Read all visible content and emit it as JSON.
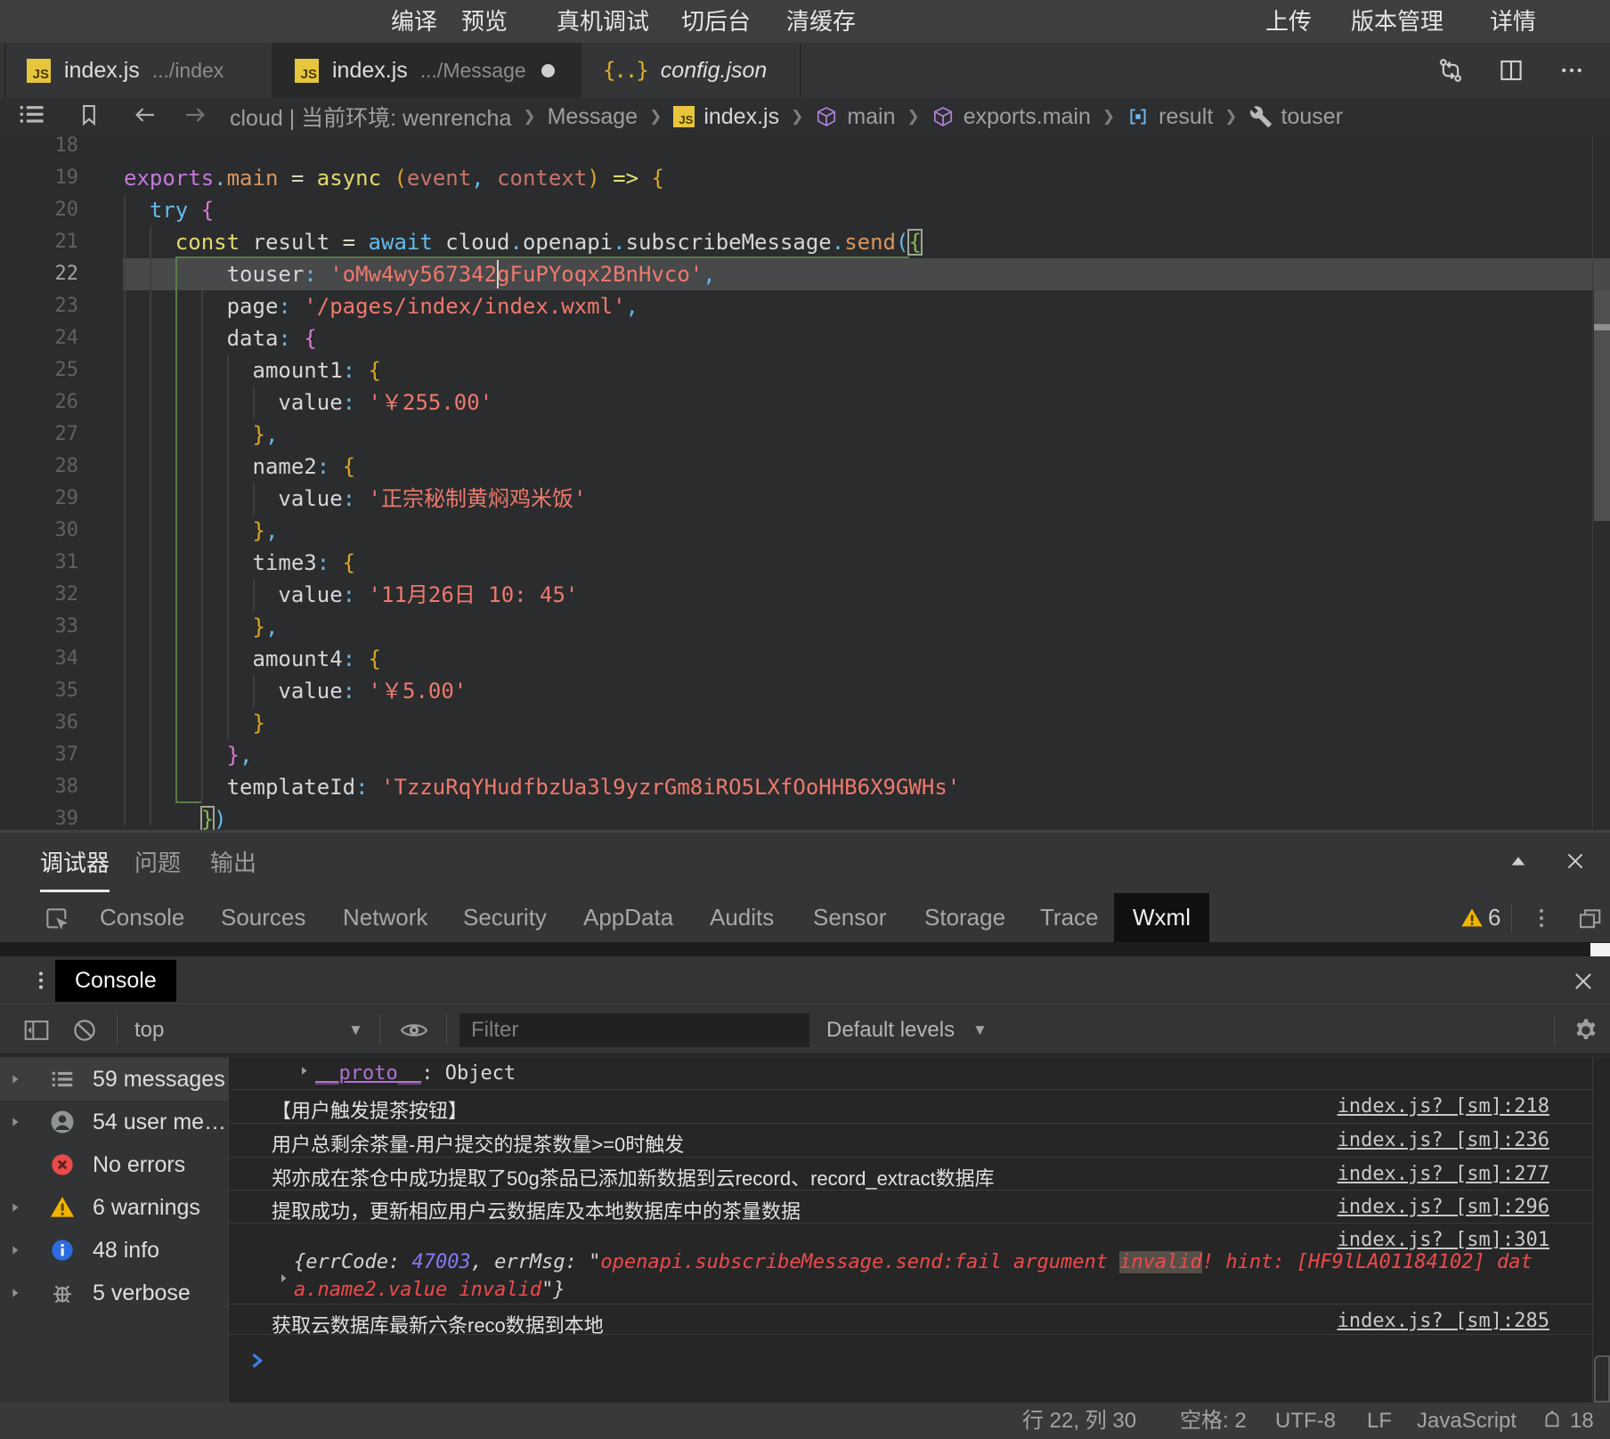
{
  "menubar": {
    "center_items": [
      "编译",
      "预览",
      "真机调试",
      "切后台",
      "清缓存"
    ],
    "right_items": [
      "上传",
      "版本管理",
      "详情"
    ]
  },
  "tabs": [
    {
      "title": "index.js",
      "hint": ".../index",
      "icon": "js",
      "active": false,
      "dirty": false,
      "italic": false
    },
    {
      "title": "index.js",
      "hint": ".../Message",
      "icon": "js",
      "active": true,
      "dirty": true,
      "italic": false
    },
    {
      "title": "config.json",
      "hint": "",
      "icon": "json",
      "active": false,
      "dirty": false,
      "italic": true
    }
  ],
  "breadcrumb": [
    {
      "label": "cloud | 当前环境: wenrencha",
      "icon": "",
      "bright": false
    },
    {
      "label": "Message",
      "icon": "",
      "bright": false
    },
    {
      "label": "index.js",
      "icon": "js",
      "bright": true
    },
    {
      "label": "main",
      "icon": "cube",
      "bright": false
    },
    {
      "label": "exports.main",
      "icon": "cube",
      "bright": false
    },
    {
      "label": "result",
      "icon": "field",
      "bright": false
    },
    {
      "label": "touser",
      "icon": "wrench",
      "bright": false
    }
  ],
  "editor": {
    "cursor": {
      "line": 22,
      "col": 29
    },
    "current_line": 22,
    "lines": [
      {
        "n": 18,
        "tokens": []
      },
      {
        "n": 19,
        "tokens": [
          [
            "pk",
            "exports"
          ],
          [
            "sk",
            "."
          ],
          [
            "or",
            "main"
          ],
          [
            "wh",
            " "
          ],
          [
            "op",
            "="
          ],
          [
            "wh",
            " "
          ],
          [
            "yl",
            "async"
          ],
          [
            "wh",
            " "
          ],
          [
            "gd",
            "("
          ],
          [
            "bk",
            "event"
          ],
          [
            "sk",
            ","
          ],
          [
            "wh",
            " "
          ],
          [
            "bk",
            "context"
          ],
          [
            "gd",
            ")"
          ],
          [
            "wh",
            " "
          ],
          [
            "aw",
            "=>"
          ],
          [
            "wh",
            " "
          ],
          [
            "gd",
            "{"
          ]
        ]
      },
      {
        "n": 20,
        "tokens": [
          [
            "wh",
            "  "
          ],
          [
            "sk",
            "try"
          ],
          [
            "wh",
            " "
          ],
          [
            "oc",
            "{"
          ]
        ]
      },
      {
        "n": 21,
        "tokens": [
          [
            "wh",
            "    "
          ],
          [
            "yl",
            "const"
          ],
          [
            "wh",
            " result "
          ],
          [
            "op",
            "="
          ],
          [
            "wh",
            " "
          ],
          [
            "sk",
            "await"
          ],
          [
            "wh",
            " cloud"
          ],
          [
            "sk",
            "."
          ],
          [
            "wh",
            "openapi"
          ],
          [
            "sk",
            "."
          ],
          [
            "wh",
            "subscribeMessage"
          ],
          [
            "sk",
            "."
          ],
          [
            "or",
            "send"
          ],
          [
            "sk",
            "("
          ],
          [
            "gr bm",
            "{"
          ]
        ]
      },
      {
        "n": 22,
        "tokens": [
          [
            "wh",
            "        touser"
          ],
          [
            "sk",
            ":"
          ],
          [
            "wh",
            " "
          ],
          [
            "st",
            "'oMw4wy567342gFuPYoqx2BnHvco'"
          ],
          [
            "sk",
            ","
          ]
        ]
      },
      {
        "n": 23,
        "tokens": [
          [
            "wh",
            "        page"
          ],
          [
            "sk",
            ":"
          ],
          [
            "wh",
            " "
          ],
          [
            "st",
            "'/pages/index/index.wxml'"
          ],
          [
            "sk",
            ","
          ]
        ]
      },
      {
        "n": 24,
        "tokens": [
          [
            "wh",
            "        data"
          ],
          [
            "sk",
            ":"
          ],
          [
            "wh",
            " "
          ],
          [
            "oc",
            "{"
          ]
        ]
      },
      {
        "n": 25,
        "tokens": [
          [
            "wh",
            "          amount1"
          ],
          [
            "sk",
            ":"
          ],
          [
            "wh",
            " "
          ],
          [
            "gd",
            "{"
          ]
        ]
      },
      {
        "n": 26,
        "tokens": [
          [
            "wh",
            "            value"
          ],
          [
            "sk",
            ":"
          ],
          [
            "wh",
            " "
          ],
          [
            "st",
            "'￥255.00'"
          ]
        ]
      },
      {
        "n": 27,
        "tokens": [
          [
            "wh",
            "          "
          ],
          [
            "gd",
            "}"
          ],
          [
            "sk",
            ","
          ]
        ]
      },
      {
        "n": 28,
        "tokens": [
          [
            "wh",
            "          name2"
          ],
          [
            "sk",
            ":"
          ],
          [
            "wh",
            " "
          ],
          [
            "gd",
            "{"
          ]
        ]
      },
      {
        "n": 29,
        "tokens": [
          [
            "wh",
            "            value"
          ],
          [
            "sk",
            ":"
          ],
          [
            "wh",
            " "
          ],
          [
            "st",
            "'正宗秘制黄焖鸡米饭'"
          ]
        ]
      },
      {
        "n": 30,
        "tokens": [
          [
            "wh",
            "          "
          ],
          [
            "gd",
            "}"
          ],
          [
            "sk",
            ","
          ]
        ]
      },
      {
        "n": 31,
        "tokens": [
          [
            "wh",
            "          time3"
          ],
          [
            "sk",
            ":"
          ],
          [
            "wh",
            " "
          ],
          [
            "gd",
            "{"
          ]
        ]
      },
      {
        "n": 32,
        "tokens": [
          [
            "wh",
            "            value"
          ],
          [
            "sk",
            ":"
          ],
          [
            "wh",
            " "
          ],
          [
            "st",
            "'11月26日 10: 45'"
          ]
        ]
      },
      {
        "n": 33,
        "tokens": [
          [
            "wh",
            "          "
          ],
          [
            "gd",
            "}"
          ],
          [
            "sk",
            ","
          ]
        ]
      },
      {
        "n": 34,
        "tokens": [
          [
            "wh",
            "          amount4"
          ],
          [
            "sk",
            ":"
          ],
          [
            "wh",
            " "
          ],
          [
            "gd",
            "{"
          ]
        ]
      },
      {
        "n": 35,
        "tokens": [
          [
            "wh",
            "            value"
          ],
          [
            "sk",
            ":"
          ],
          [
            "wh",
            " "
          ],
          [
            "st",
            "'￥5.00'"
          ]
        ]
      },
      {
        "n": 36,
        "tokens": [
          [
            "wh",
            "          "
          ],
          [
            "gd",
            "}"
          ]
        ]
      },
      {
        "n": 37,
        "tokens": [
          [
            "wh",
            "        "
          ],
          [
            "oc",
            "}"
          ],
          [
            "sk",
            ","
          ]
        ]
      },
      {
        "n": 38,
        "tokens": [
          [
            "wh",
            "        templateId"
          ],
          [
            "sk",
            ":"
          ],
          [
            "wh",
            " "
          ],
          [
            "st",
            "'TzzuRqYHudfbzUa3l9yzrGm8iRO5LXfOoHHB6X9GWHs'"
          ]
        ]
      },
      {
        "n": 39,
        "tokens": [
          [
            "wh",
            "      "
          ],
          [
            "gr bm",
            "}"
          ],
          [
            "sk",
            ")"
          ]
        ]
      }
    ]
  },
  "debugger_tabs": {
    "items": [
      "调试器",
      "问题",
      "输出"
    ],
    "active_index": 0
  },
  "devtools": {
    "tabs": [
      "Console",
      "Sources",
      "Network",
      "Security",
      "AppData",
      "Audits",
      "Sensor",
      "Storage",
      "Trace",
      "Wxml"
    ],
    "active_tab": "Wxml",
    "warning_count": "6"
  },
  "console": {
    "drawer_tab": "Console",
    "context": "top",
    "filter_placeholder": "Filter",
    "levels_label": "Default levels",
    "sidebar": [
      {
        "label": "59 messages",
        "icon": "list",
        "selected": true,
        "arrow": true
      },
      {
        "label": "54 user me…",
        "icon": "user",
        "selected": false,
        "arrow": true
      },
      {
        "label": "No errors",
        "icon": "error",
        "selected": false,
        "arrow": false
      },
      {
        "label": "6 warnings",
        "icon": "warning",
        "selected": false,
        "arrow": true
      },
      {
        "label": "48 info",
        "icon": "info",
        "selected": false,
        "arrow": true
      },
      {
        "label": "5 verbose",
        "icon": "verbose",
        "selected": false,
        "arrow": true
      }
    ],
    "messages": [
      {
        "type": "proto",
        "key": "__proto__",
        "rest": ": Object"
      },
      {
        "type": "log",
        "text": "【用户触发提茶按钮】",
        "link": "index.js? [sm]:218"
      },
      {
        "type": "log",
        "text": "用户总剩余茶量-用户提交的提茶数量>=0时触发",
        "link": "index.js? [sm]:236"
      },
      {
        "type": "log",
        "text": "郑亦成在茶仓中成功提取了50g茶品已添加新数据到云record、record_extract数据库",
        "link": "index.js? [sm]:277"
      },
      {
        "type": "log",
        "text": "提取成功，更新相应用户云数据库及本地数据库中的茶量数据",
        "link": "index.js? [sm]:296"
      },
      {
        "type": "error",
        "link": "index.js? [sm]:301",
        "l1_obj": "{errCode: ",
        "l1_num": "47003",
        "l1_mid": ", errMsg: \"",
        "l1_red_a": "openapi.subscribeMessage.send:fail argument ",
        "l1_hl": "invalid",
        "l1_red_b": "! hint: [HF9lLA01184102] dat",
        "l2_red": "a.name2.value invalid",
        "l2_tail": "\"}"
      },
      {
        "type": "log",
        "text": "获取云数据库最新六条reco数据到本地",
        "link": "index.js? [sm]:285"
      },
      {
        "type": "prompt"
      }
    ]
  },
  "statusbar": {
    "items": [
      "行 22, 列 30",
      "空格: 2",
      "UTF-8",
      "LF",
      "JavaScript"
    ],
    "bell_count": "18"
  }
}
